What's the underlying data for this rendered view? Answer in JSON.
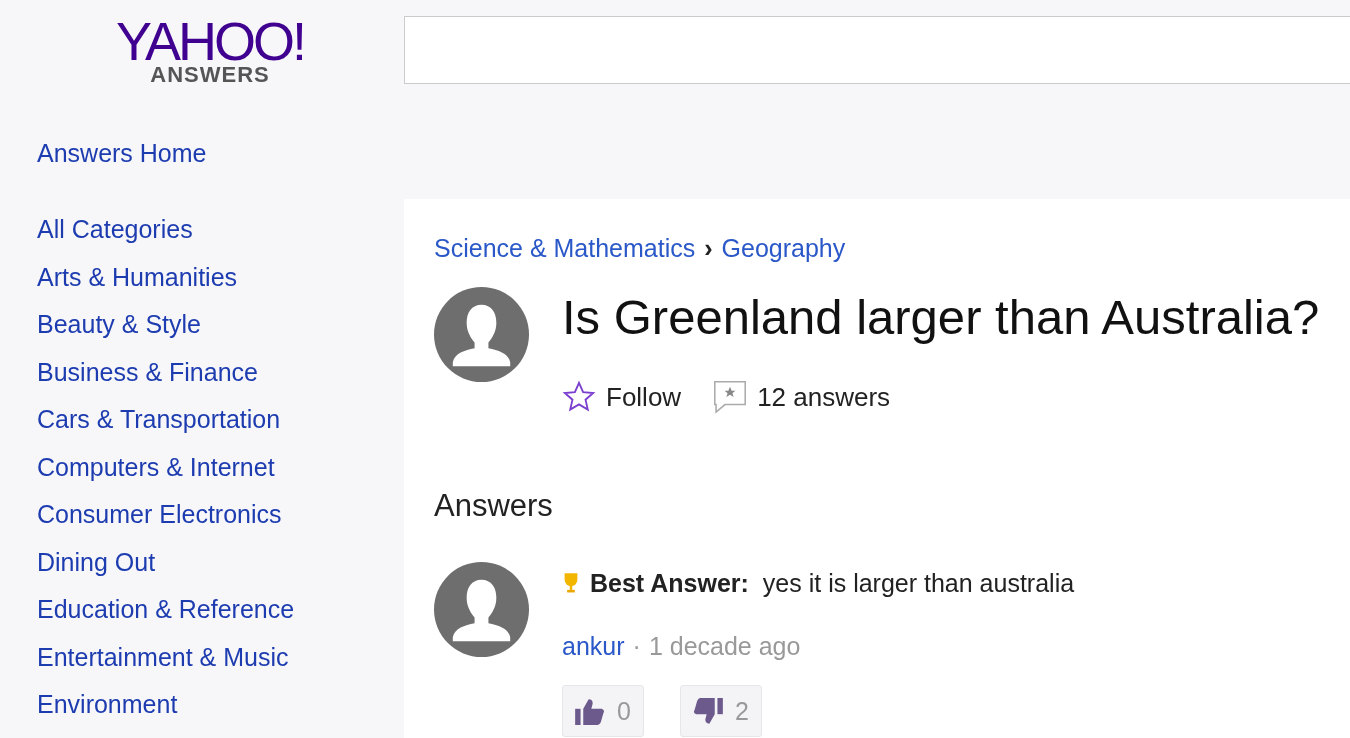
{
  "logo": {
    "brand": "YAHOO!",
    "product": "ANSWERS"
  },
  "sidebar": {
    "home": "Answers Home",
    "categories": [
      "All Categories",
      "Arts & Humanities",
      "Beauty & Style",
      "Business & Finance",
      "Cars & Transportation",
      "Computers & Internet",
      "Consumer Electronics",
      "Dining Out",
      "Education & Reference",
      "Entertainment & Music",
      "Environment"
    ]
  },
  "question": {
    "breadcrumb": [
      "Science & Mathematics",
      "Geography"
    ],
    "separator": "›",
    "title": "Is Greenland larger than Australia?",
    "follow": "Follow",
    "answers_count": "12 answers"
  },
  "answers_heading": "Answers",
  "answers": [
    {
      "label": "Best Answer:",
      "text": "yes it is larger than australia",
      "author": "ankur",
      "dot": "·",
      "time": "1 decade ago",
      "upvotes": "0",
      "downvotes": "2"
    }
  ]
}
